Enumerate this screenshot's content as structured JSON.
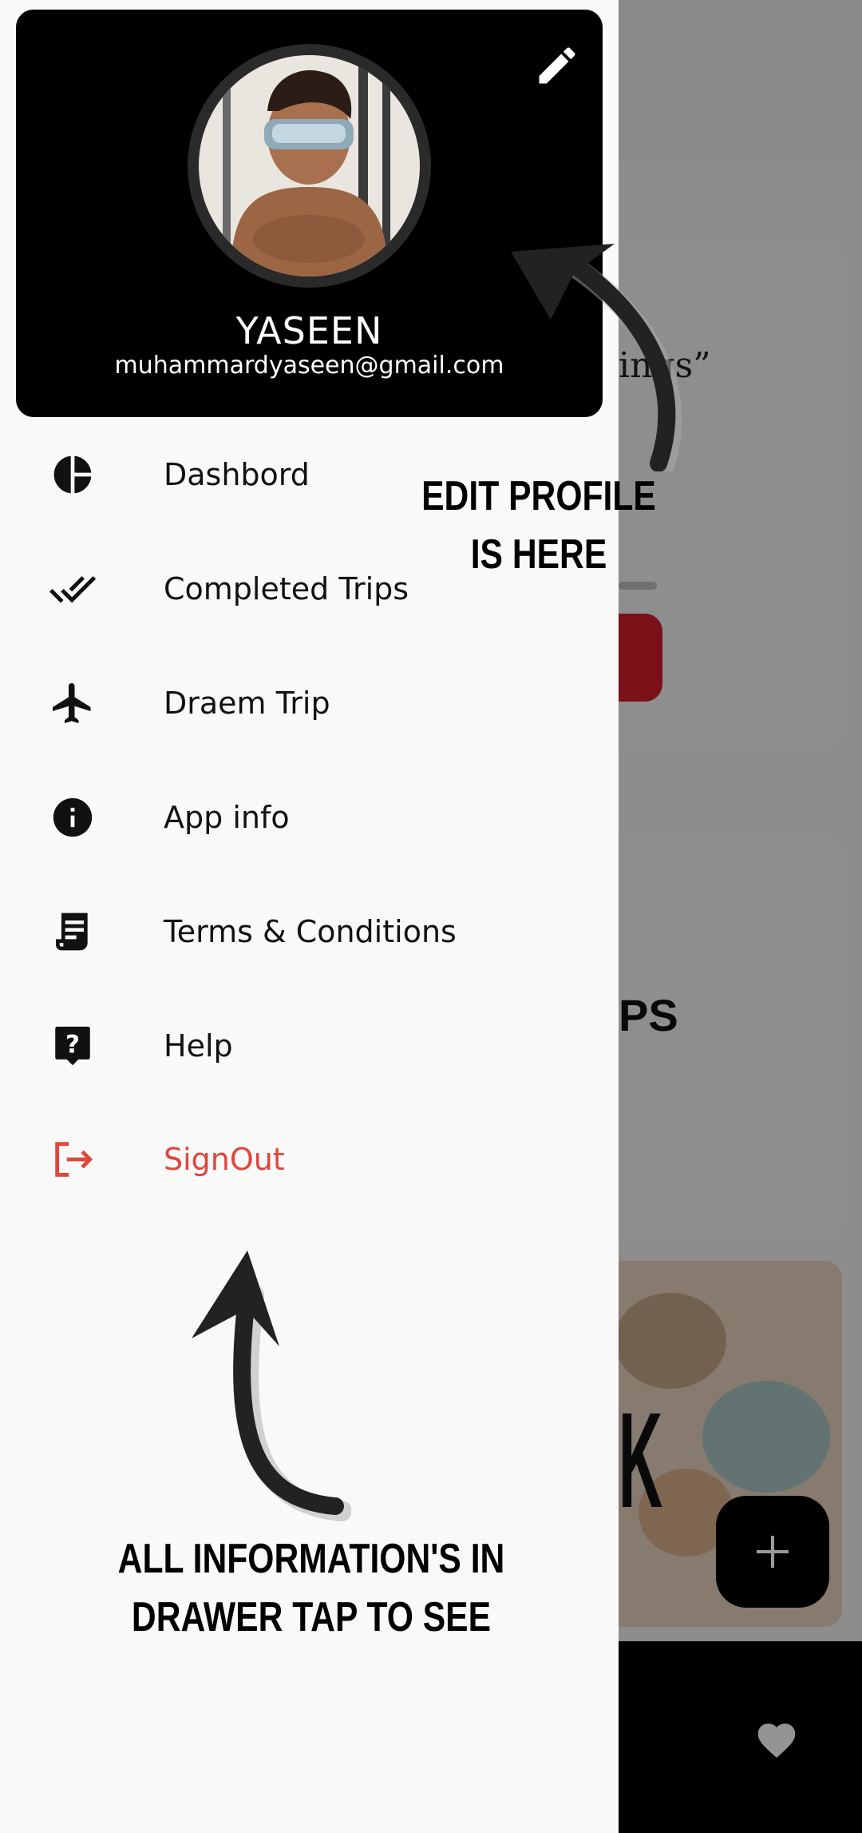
{
  "profile": {
    "name": "YASEEN",
    "email": "muhammardyaseen@gmail.com",
    "edit_icon": "pencil-icon",
    "avatar": "profile-photo"
  },
  "menu": [
    {
      "label": "Dashbord",
      "icon": "pie-chart-icon"
    },
    {
      "label": "Completed Trips",
      "icon": "double-check-icon"
    },
    {
      "label": "Draem Trip",
      "icon": "airplane-icon"
    },
    {
      "label": "App info",
      "icon": "info-icon"
    },
    {
      "label": "Terms & Conditions",
      "icon": "receipt-icon"
    },
    {
      "label": "Help",
      "icon": "help-icon"
    },
    {
      "label": "SignOut",
      "icon": "logout-icon"
    }
  ],
  "annotations": {
    "edit_profile": "EDIT PROFILE IS HERE",
    "drawer_info": "ALL INFORMATION'S IN DRAWER TAP TO SEE"
  },
  "background": {
    "card1_text": "ings”",
    "card2_text": "PS",
    "card3_text": "K"
  },
  "colors": {
    "header_bg": "#000000",
    "drawer_bg": "#f9f9f9",
    "signout": "#e0463c",
    "scrim": "rgba(0,0,0,0.42)"
  }
}
